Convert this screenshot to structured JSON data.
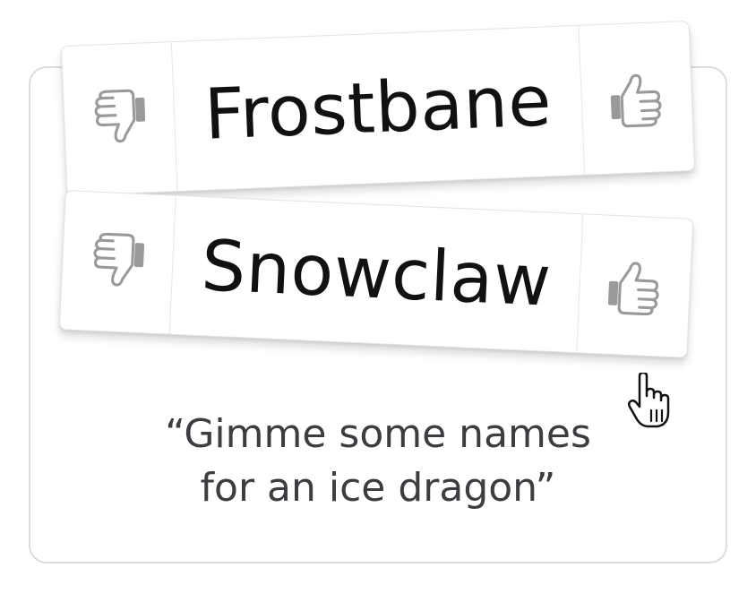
{
  "cards": [
    {
      "name": "Frostbane"
    },
    {
      "name": "Snowclaw"
    }
  ],
  "prompt": {
    "line1": "“Gimme some names",
    "line2": "for an ice dragon”"
  },
  "icons": {
    "thumbs_down": "thumbs-down-icon",
    "thumbs_up": "thumbs-up-icon",
    "cursor": "hand-pointer-icon"
  },
  "colors": {
    "icon_gray": "#9a9a9a",
    "text": "#111111",
    "prompt_text": "#3b3d40",
    "border": "#dcdcdc"
  }
}
